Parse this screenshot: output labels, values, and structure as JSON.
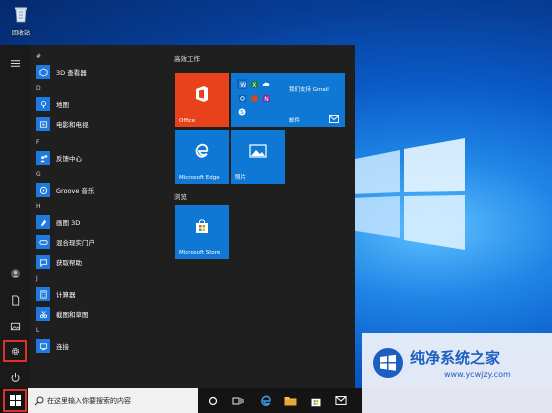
{
  "desktop": {
    "recycle_bin_label": "回收站"
  },
  "rail": {
    "buttons": [
      "menu-icon",
      "user-icon",
      "documents-icon",
      "pictures-icon",
      "settings-icon",
      "power-icon"
    ]
  },
  "app_list": {
    "items": [
      {
        "type": "header",
        "text": "#"
      },
      {
        "type": "app",
        "name": "3D 查看器",
        "icon": "cube-icon"
      },
      {
        "type": "header",
        "text": "D"
      },
      {
        "type": "app",
        "name": "地图",
        "icon": "map-icon"
      },
      {
        "type": "app",
        "name": "电影和电视",
        "icon": "film-icon"
      },
      {
        "type": "header",
        "text": "F"
      },
      {
        "type": "app",
        "name": "反馈中心",
        "icon": "feedback-icon"
      },
      {
        "type": "header",
        "text": "G"
      },
      {
        "type": "app",
        "name": "Groove 音乐",
        "icon": "music-icon"
      },
      {
        "type": "header",
        "text": "H"
      },
      {
        "type": "app",
        "name": "画图 3D",
        "icon": "paint-icon"
      },
      {
        "type": "app",
        "name": "混合现实门户",
        "icon": "mixed-reality-icon"
      },
      {
        "type": "app",
        "name": "获取帮助",
        "icon": "help-icon"
      },
      {
        "type": "header",
        "text": "J"
      },
      {
        "type": "app",
        "name": "计算器",
        "icon": "calculator-icon"
      },
      {
        "type": "app",
        "name": "截图和草图",
        "icon": "snip-icon"
      },
      {
        "type": "header",
        "text": "L"
      },
      {
        "type": "app",
        "name": "连接",
        "icon": "connect-icon"
      }
    ]
  },
  "tiles": {
    "group1_title": "高效工作",
    "group2_title": "浏览",
    "office_label": "Office",
    "mail_label": "邮件",
    "gmail_text": "我们支持 Gmail",
    "edge_label": "Microsoft Edge",
    "photos_label": "照片",
    "store_label": "Microsoft Store"
  },
  "taskbar": {
    "search_placeholder": "在这里输入你要搜索的内容"
  },
  "watermark": {
    "title": "纯净系统之家",
    "url": "www.ycwjzy.com"
  },
  "colors": {
    "office_tile": "#e8421d",
    "blue_tile": "#0f78d4",
    "highlight": "#e0302c"
  }
}
